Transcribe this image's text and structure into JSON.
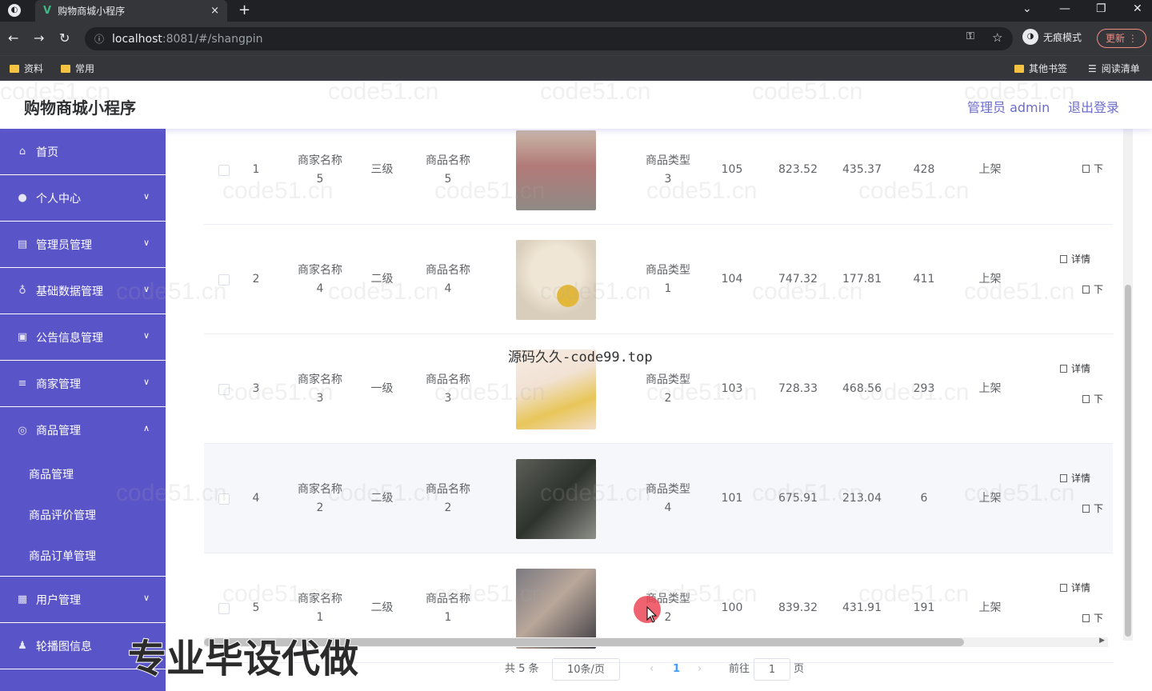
{
  "browser": {
    "tab_title": "购物商城小程序",
    "tab_close": "×",
    "new_tab": "+",
    "url_host": "localhost",
    "url_path": ":8081/#/shangpin",
    "profile_label": "无痕模式",
    "update_label": "更新",
    "bookmarks": [
      "资料",
      "常用"
    ],
    "bookmarks_right": [
      "其他书签",
      "阅读清单"
    ]
  },
  "header": {
    "title": "购物商城小程序",
    "admin_label": "管理员 admin",
    "logout_label": "退出登录"
  },
  "sidebar": {
    "items": [
      {
        "label": "首页",
        "icon": "home-icon"
      },
      {
        "label": "个人中心",
        "icon": "user-icon"
      },
      {
        "label": "管理员管理",
        "icon": "admin-icon"
      },
      {
        "label": "基础数据管理",
        "icon": "data-icon"
      },
      {
        "label": "公告信息管理",
        "icon": "notice-icon"
      },
      {
        "label": "商家管理",
        "icon": "store-icon"
      },
      {
        "label": "商品管理",
        "icon": "goods-icon"
      },
      {
        "label": "用户管理",
        "icon": "users-icon"
      },
      {
        "label": "轮播图信息",
        "icon": "carousel-icon"
      }
    ],
    "submenu": [
      "商品管理",
      "商品评价管理",
      "商品订单管理"
    ]
  },
  "table": {
    "rows": [
      {
        "index": "1",
        "merchant": [
          "商家名称",
          "5"
        ],
        "level": "三级",
        "name": [
          "商品名称",
          "5"
        ],
        "type": [
          "商品类型",
          "3"
        ],
        "stock": "105",
        "original_price": "823.52",
        "price": "435.37",
        "clicks": "428",
        "status": "上架"
      },
      {
        "index": "2",
        "merchant": [
          "商家名称",
          "4"
        ],
        "level": "二级",
        "name": [
          "商品名称",
          "4"
        ],
        "type": [
          "商品类型",
          "1"
        ],
        "stock": "104",
        "original_price": "747.32",
        "price": "177.81",
        "clicks": "411",
        "status": "上架"
      },
      {
        "index": "3",
        "merchant": [
          "商家名称",
          "3"
        ],
        "level": "一级",
        "name": [
          "商品名称",
          "3"
        ],
        "type": [
          "商品类型",
          "2"
        ],
        "stock": "103",
        "original_price": "728.33",
        "price": "468.56",
        "clicks": "293",
        "status": "上架"
      },
      {
        "index": "4",
        "merchant": [
          "商家名称",
          "2"
        ],
        "level": "二级",
        "name": [
          "商品名称",
          "2"
        ],
        "type": [
          "商品类型",
          "4"
        ],
        "stock": "101",
        "original_price": "675.91",
        "price": "213.04",
        "clicks": "6",
        "status": "上架"
      },
      {
        "index": "5",
        "merchant": [
          "商家名称",
          "1"
        ],
        "level": "二级",
        "name": [
          "商品名称",
          "1"
        ],
        "type": [
          "商品类型",
          "2"
        ],
        "stock": "100",
        "original_price": "839.32",
        "price": "431.91",
        "clicks": "191",
        "status": "上架"
      }
    ],
    "action_detail": "详情",
    "action_down": "下"
  },
  "pagination": {
    "total": "共 5 条",
    "page_size": "10条/页",
    "current_page": "1",
    "goto_label": "前往",
    "goto_value": "1",
    "page_unit": "页"
  },
  "overlay": {
    "watermark_text": "code51.cn",
    "source_text": "源码久久-code99.top",
    "promo_text": "专业毕设代做"
  }
}
